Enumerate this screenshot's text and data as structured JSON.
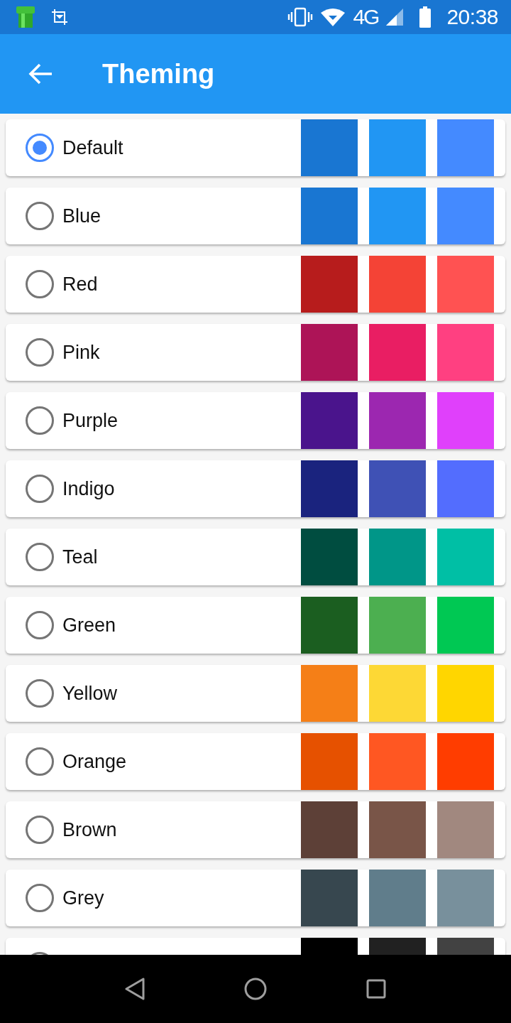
{
  "status_bar": {
    "network": "4G",
    "time": "20:38"
  },
  "app_bar": {
    "title": "Theming"
  },
  "themes": [
    {
      "label": "Default",
      "selected": true,
      "swatches": [
        {
          "color": "#1976d2"
        },
        {
          "color": "#2196f3"
        },
        {
          "color": "#448aff"
        }
      ]
    },
    {
      "label": "Blue",
      "selected": false,
      "swatches": [
        {
          "color": "#1976d2"
        },
        {
          "color": "#2196f3"
        },
        {
          "color": "#448aff"
        }
      ]
    },
    {
      "label": "Red",
      "selected": false,
      "swatches": [
        {
          "color": "#b71c1c"
        },
        {
          "color": "#f44336"
        },
        {
          "color": "#ff5252"
        }
      ]
    },
    {
      "label": "Pink",
      "selected": false,
      "swatches": [
        {
          "color": "#ad1457"
        },
        {
          "color": "#e91e63"
        },
        {
          "color": "#ff4081"
        }
      ]
    },
    {
      "label": "Purple",
      "selected": false,
      "swatches": [
        {
          "color": "#4a148c"
        },
        {
          "color": "#9c27b0"
        },
        {
          "color": "#e040fb"
        }
      ]
    },
    {
      "label": "Indigo",
      "selected": false,
      "swatches": [
        {
          "color": "#1a237e"
        },
        {
          "color": "#3f51b5"
        },
        {
          "color": "#536dfe"
        }
      ]
    },
    {
      "label": "Teal",
      "selected": false,
      "swatches": [
        {
          "color": "#004d40"
        },
        {
          "color": "#009688"
        },
        {
          "color": "#00bfa5"
        }
      ]
    },
    {
      "label": "Green",
      "selected": false,
      "swatches": [
        {
          "color": "#1b5e20"
        },
        {
          "color": "#4caf50"
        },
        {
          "color": "#00c853"
        }
      ]
    },
    {
      "label": "Yellow",
      "selected": false,
      "swatches": [
        {
          "color": "#f57f17"
        },
        {
          "color": "#fdd835"
        },
        {
          "color": "#ffd600"
        }
      ]
    },
    {
      "label": "Orange",
      "selected": false,
      "swatches": [
        {
          "color": "#e65100"
        },
        {
          "color": "#ff5722"
        },
        {
          "color": "#ff3d00"
        }
      ]
    },
    {
      "label": "Brown",
      "selected": false,
      "swatches": [
        {
          "color": "#5d4037"
        },
        {
          "color": "#795548"
        },
        {
          "color": "#a1887f"
        }
      ]
    },
    {
      "label": "Grey",
      "selected": false,
      "swatches": [
        {
          "color": "#37474f"
        },
        {
          "color": "#607d8b"
        },
        {
          "color": "#78909c"
        }
      ]
    },
    {
      "selected": false,
      "swatches": [
        {
          "color": "#000000"
        },
        {
          "color": "#212121"
        },
        {
          "color": "#424242"
        }
      ]
    }
  ]
}
